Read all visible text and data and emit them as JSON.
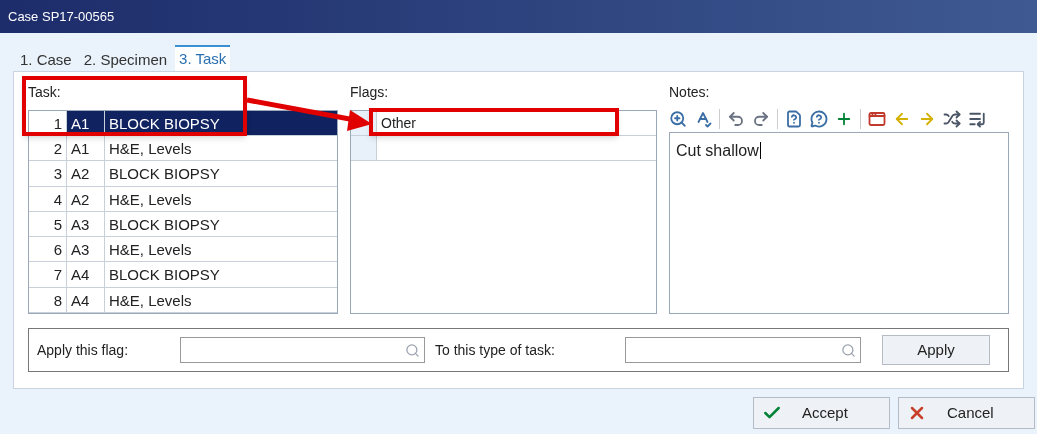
{
  "window": {
    "title": "Case SP17-00565"
  },
  "tabs": [
    {
      "label": "1. Case",
      "selected": false
    },
    {
      "label": "2. Specimen",
      "selected": false
    },
    {
      "label": "3. Task",
      "selected": true
    }
  ],
  "task": {
    "label": "Task:",
    "rows": [
      {
        "number": "1",
        "block": "A1",
        "name": "BLOCK BIOPSY",
        "selected": true
      },
      {
        "number": "2",
        "block": "A1",
        "name": "H&E, Levels",
        "selected": false
      },
      {
        "number": "3",
        "block": "A2",
        "name": "BLOCK BIOPSY",
        "selected": false
      },
      {
        "number": "4",
        "block": "A2",
        "name": "H&E, Levels",
        "selected": false
      },
      {
        "number": "5",
        "block": "A3",
        "name": "BLOCK BIOPSY",
        "selected": false
      },
      {
        "number": "6",
        "block": "A3",
        "name": "H&E, Levels",
        "selected": false
      },
      {
        "number": "7",
        "block": "A4",
        "name": "BLOCK BIOPSY",
        "selected": false
      },
      {
        "number": "8",
        "block": "A4",
        "name": "H&E, Levels",
        "selected": false
      }
    ]
  },
  "flags": {
    "label": "Flags:",
    "rows": [
      "Other",
      ""
    ]
  },
  "notes": {
    "label": "Notes:",
    "value": "Cut shallow"
  },
  "apply_row": {
    "flag_label": "Apply this flag:",
    "task_type_label": "To this type of task:",
    "button": "Apply"
  },
  "buttons": [
    {
      "kind": "accept",
      "label": "Accept"
    },
    {
      "kind": "cancel",
      "label": "Cancel"
    }
  ]
}
